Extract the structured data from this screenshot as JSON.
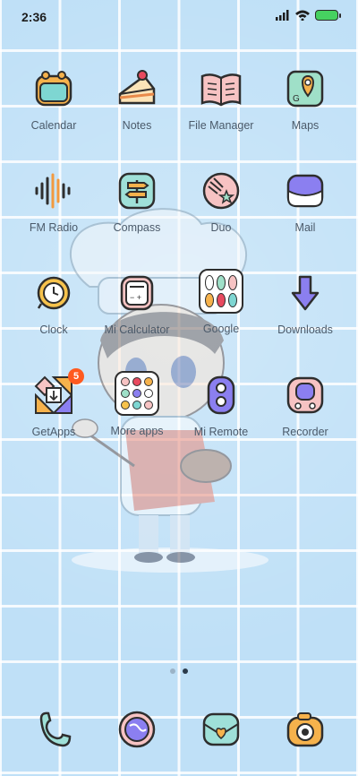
{
  "status_bar": {
    "time": "2:36",
    "icons": [
      "signal-icon",
      "wifi-icon",
      "battery-charging-icon"
    ]
  },
  "apps": [
    {
      "label": "Calendar",
      "icon": "calendar-icon"
    },
    {
      "label": "Notes",
      "icon": "cake-notes-icon"
    },
    {
      "label": "File Manager",
      "icon": "open-book-icon"
    },
    {
      "label": "Maps",
      "icon": "map-pin-icon"
    },
    {
      "label": "FM Radio",
      "icon": "sound-wave-icon"
    },
    {
      "label": "Compass",
      "icon": "signpost-icon"
    },
    {
      "label": "Duo",
      "icon": "shooting-star-icon"
    },
    {
      "label": "Mail",
      "icon": "envelope-icon"
    },
    {
      "label": "Clock",
      "icon": "alarm-clock-icon"
    },
    {
      "label": "Mi Calculator",
      "icon": "calculator-icon"
    },
    {
      "label": "Google",
      "icon": "folder-icon"
    },
    {
      "label": "Downloads",
      "icon": "download-arrow-icon"
    },
    {
      "label": "GetApps",
      "icon": "getapps-icon",
      "badge": "5"
    },
    {
      "label": "More apps",
      "icon": "folder-icon"
    },
    {
      "label": "Mi Remote",
      "icon": "remote-icon"
    },
    {
      "label": "Recorder",
      "icon": "recorder-icon"
    }
  ],
  "page_indicator": {
    "count": 2,
    "active": 2
  },
  "dock": [
    {
      "icon": "phone-icon"
    },
    {
      "icon": "browser-globe-icon"
    },
    {
      "icon": "messages-icon"
    },
    {
      "icon": "camera-icon"
    }
  ],
  "colors": {
    "background": "#bfe0f7",
    "grid_lines": "#ffffff",
    "badge": "#ff5a1f",
    "label": "#4b5a6a"
  }
}
